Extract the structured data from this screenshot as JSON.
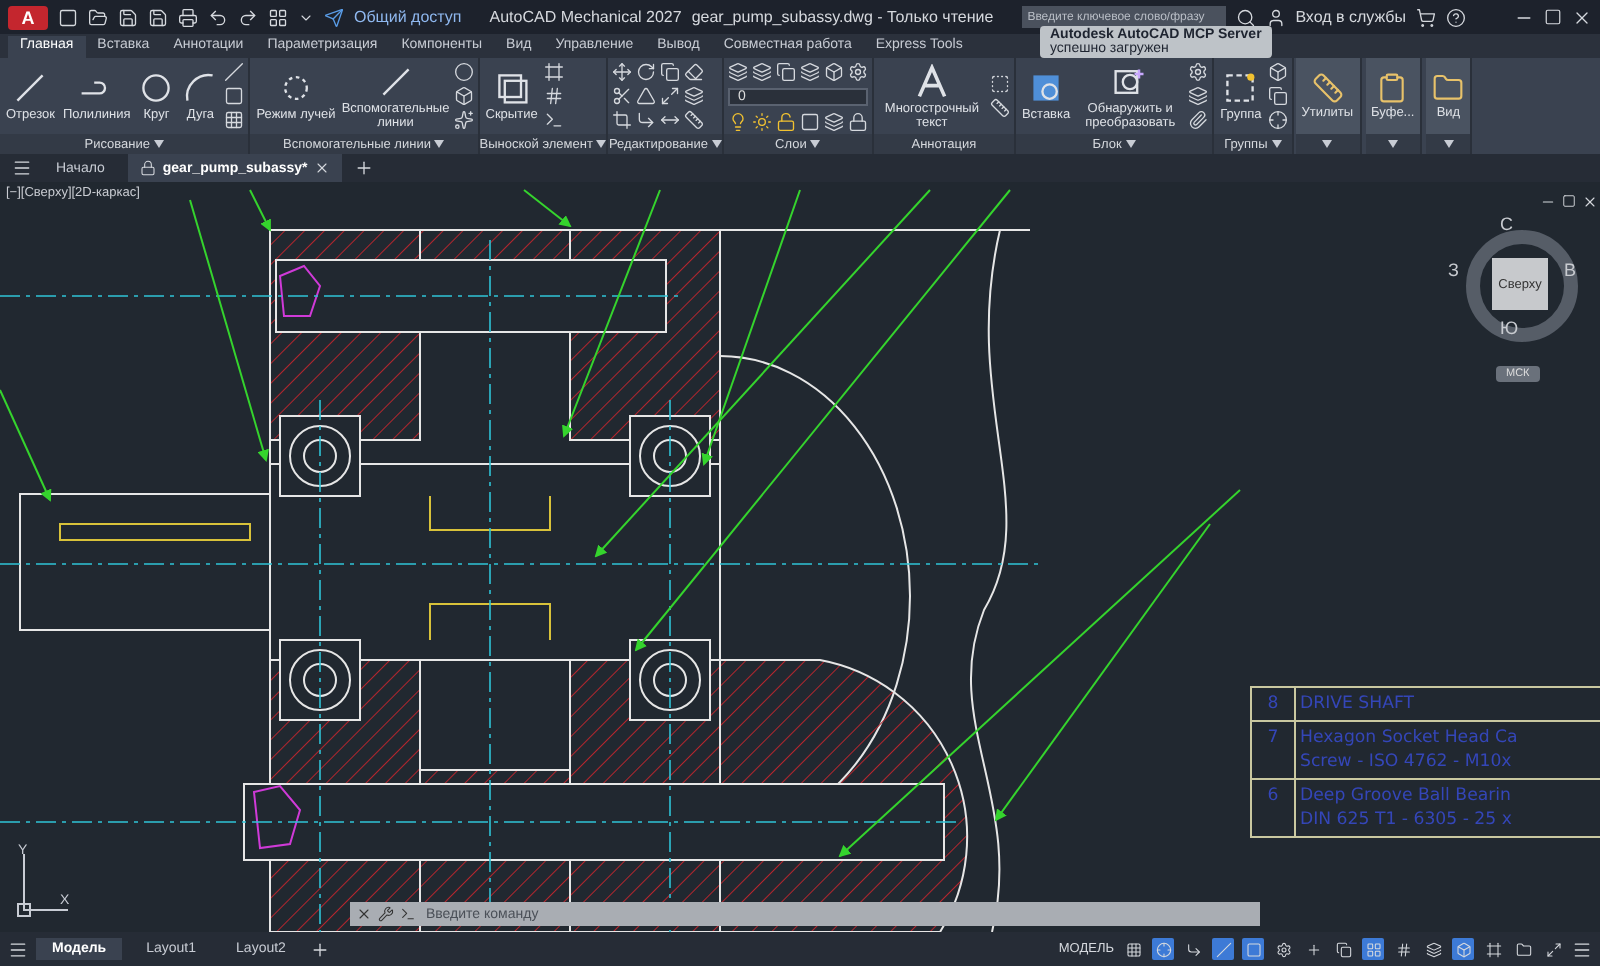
{
  "title_bar": {
    "app_button": "A",
    "share_label": "Общий доступ",
    "app_name": "AutoCAD Mechanical 2027",
    "document_title": "gear_pump_subassy.dwg - Только чтение",
    "search": {
      "placeholder": "Введите ключевое слово/фразу"
    },
    "sign_in": "Вход в службы"
  },
  "ribbon_tabs": [
    {
      "label": "Главная",
      "selected": true
    },
    {
      "label": "Вставка",
      "selected": false
    },
    {
      "label": "Аннотации",
      "selected": false
    },
    {
      "label": "Параметризация",
      "selected": false
    },
    {
      "label": "Компоненты",
      "selected": false
    },
    {
      "label": "Вид",
      "selected": false
    },
    {
      "label": "Управление",
      "selected": false
    },
    {
      "label": "Вывод",
      "selected": false
    },
    {
      "label": "Совместная работа",
      "selected": false
    },
    {
      "label": "Express Tools",
      "selected": false
    }
  ],
  "ribbon_panels": [
    {
      "kind": "panel",
      "title": "Рисование",
      "menu": true,
      "tools": [
        "Отрезок",
        "Полилиния",
        "Круг",
        "Дуга"
      ]
    },
    {
      "kind": "panel",
      "title": "Вспомогательные линии",
      "menu": true,
      "tools": [
        "Режим лучей",
        "Вспомогательные линии"
      ]
    },
    {
      "kind": "panel",
      "title": "Выноской элемент",
      "menu": true,
      "tools": [
        "Скрытие"
      ]
    },
    {
      "kind": "grid",
      "title": "Редактирование",
      "menu": true
    },
    {
      "kind": "layers",
      "title": "Слои",
      "menu": true,
      "layer": "0"
    },
    {
      "kind": "panel",
      "title": "Аннотация",
      "menu": false,
      "tools": [
        "Многострочный текст"
      ]
    },
    {
      "kind": "panel",
      "title": "Блок",
      "menu": true,
      "tools": [
        "Вставка",
        "Обнаружить и преобразовать"
      ]
    },
    {
      "kind": "panel",
      "title": "Группы",
      "menu": true,
      "tools": [
        "Группа"
      ]
    },
    {
      "kind": "collapsed",
      "label": "Утилиты"
    },
    {
      "kind": "collapsed",
      "label": "Буфе..."
    },
    {
      "kind": "collapsed",
      "label": "Вид"
    }
  ],
  "notification": {
    "title": "Autodesk AutoCAD MCP Server",
    "message": "успешно загружен"
  },
  "document_tabs": [
    {
      "label": "Начало",
      "selected": false,
      "locked": false
    },
    {
      "label": "gear_pump_subassy*",
      "selected": true,
      "locked": true
    }
  ],
  "canvas": {
    "viewport_label": "[−][Сверху][2D-каркас]",
    "viewcube": {
      "north": "С",
      "east": "В",
      "south": "Ю",
      "west": "З",
      "face": "Сверху",
      "ucs": "МСК"
    },
    "ucs_icon": {
      "x_axis": "X",
      "y_axis": "Y"
    },
    "parts_table": [
      {
        "number": "8",
        "lines": [
          "DRIVE SHAFT"
        ]
      },
      {
        "number": "7",
        "lines": [
          "Hexagon Socket Head Ca",
          "Screw - ISO 4762 - M10x"
        ]
      },
      {
        "number": "6",
        "lines": [
          "Deep Groove Ball Bearin",
          "DIN 625 T1 - 6305 - 25 x"
        ]
      }
    ],
    "command_line": {
      "placeholder": "Введите команду"
    }
  },
  "layout_tabs": [
    {
      "label": "Модель",
      "selected": true
    },
    {
      "label": "Layout1",
      "selected": false
    },
    {
      "label": "Layout2",
      "selected": false
    }
  ],
  "status_bar": {
    "mode": "МОДЕЛЬ",
    "toggles": [
      {
        "on": false
      },
      {
        "on": true
      },
      {
        "on": false
      },
      {
        "on": true
      },
      {
        "on": true
      },
      {
        "on": false
      },
      {
        "on": false
      },
      {
        "on": false
      },
      {
        "on": true
      },
      {
        "on": false
      },
      {
        "on": false
      },
      {
        "on": true
      },
      {
        "on": false
      },
      {
        "on": false
      },
      {
        "on": false
      }
    ]
  }
}
